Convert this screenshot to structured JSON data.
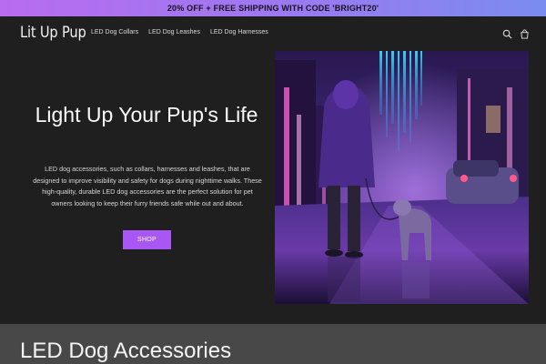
{
  "announcement": {
    "text": "20% OFF + FREE SHIPPING WITH CODE 'BRIGHT20'"
  },
  "header": {
    "logo": "Lit Up Pup",
    "nav": [
      {
        "label": "LED Dog Collars"
      },
      {
        "label": "LED Dog Leashes"
      },
      {
        "label": "LED Dog Harnesses"
      }
    ],
    "icons": [
      "search-icon",
      "cart-icon"
    ]
  },
  "hero": {
    "title": "Light Up Your Pup's Life",
    "description": "LED dog accessories, such as collars, harnesses and leashes, that are designed to improve visibility and safety for dogs during nighttime walks. These high-quality, durable LED dog accessories are the perfect solution for pet owners looking to keep their furry friends safe while out and about.",
    "button_label": "SHOP"
  },
  "section": {
    "title": "LED Dog Accessories"
  },
  "colors": {
    "accent": "#a857f2",
    "background": "#1f1f1f",
    "band": "#484848"
  }
}
